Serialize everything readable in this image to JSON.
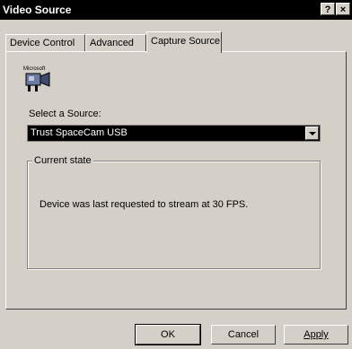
{
  "window": {
    "title": "Video Source",
    "help_glyph": "?",
    "close_glyph": "×"
  },
  "tabs": [
    {
      "label": "Device Control",
      "active": false
    },
    {
      "label": "Advanced",
      "active": false
    },
    {
      "label": "Capture Source",
      "active": true
    }
  ],
  "icon": {
    "name": "microsoft-camera-icon",
    "text": "Microsoft"
  },
  "source": {
    "label": "Select a Source:",
    "selected": "Trust SpaceCam USB"
  },
  "state": {
    "group_title": "Current state",
    "message": "Device was last requested to stream at 30 FPS."
  },
  "buttons": {
    "ok": "OK",
    "cancel": "Cancel",
    "apply": "Apply"
  }
}
